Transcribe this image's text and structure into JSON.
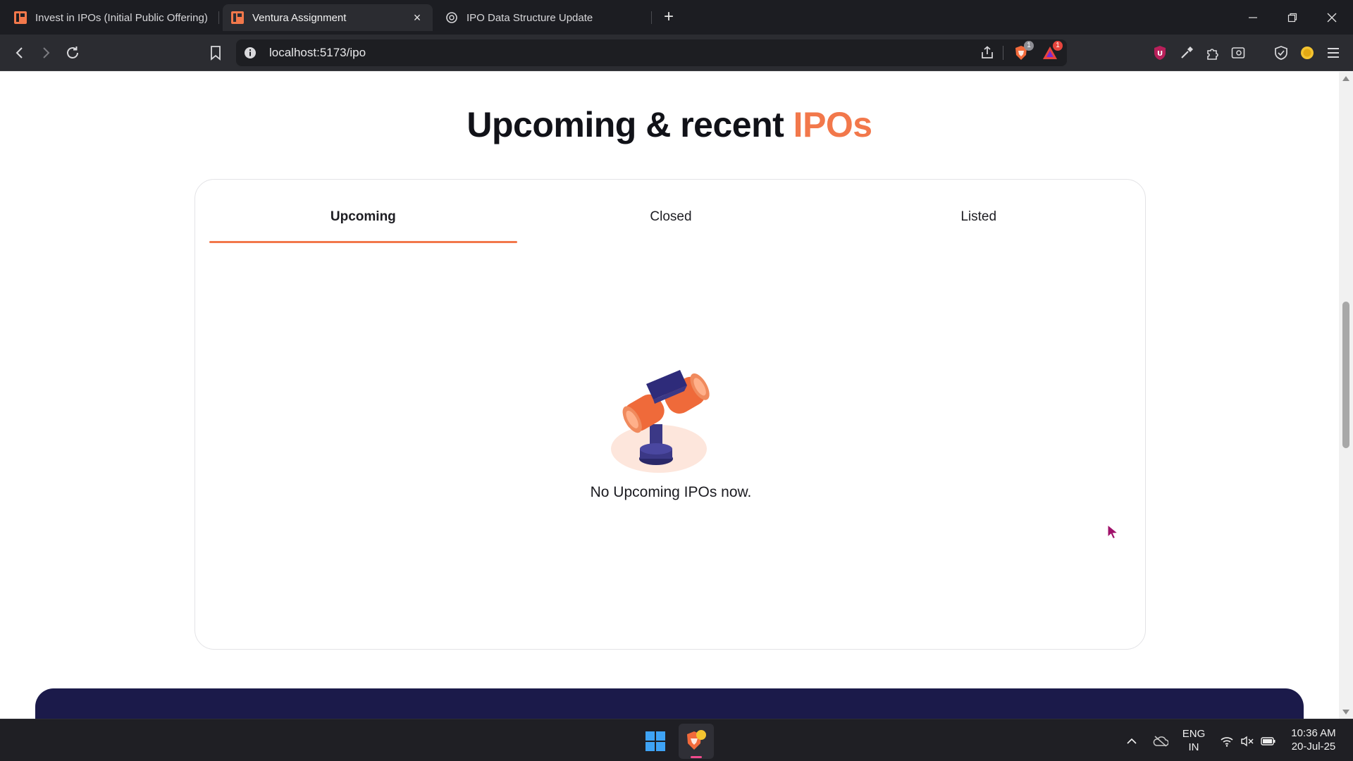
{
  "browser": {
    "tabs": [
      {
        "title": "Invest in IPOs (Initial Public Offering)",
        "active": false,
        "favicon": "ventura-logo-icon"
      },
      {
        "title": "Ventura Assignment",
        "active": true,
        "favicon": "ventura-logo-icon"
      },
      {
        "title": "IPO Data Structure Update",
        "active": false,
        "favicon": "chatgpt-icon"
      }
    ],
    "close_tab_glyph": "×",
    "new_tab_glyph": "+",
    "url": "localhost:5173/ipo",
    "shields_badge": "1",
    "rewards_badge": "1"
  },
  "page": {
    "heading_main": "Upcoming & recent ",
    "heading_accent": "IPOs",
    "tabs": [
      "Upcoming",
      "Closed",
      "Listed"
    ],
    "active_tab": "Upcoming",
    "empty_message": "No Upcoming IPOs now."
  },
  "taskbar": {
    "language_line1": "ENG",
    "language_line2": "IN",
    "time": "10:36 AM",
    "date": "20-Jul-25"
  },
  "colors": {
    "accent": "#f2784b",
    "footer_band": "#1b1a4a",
    "chrome_dark": "#1c1d22"
  }
}
